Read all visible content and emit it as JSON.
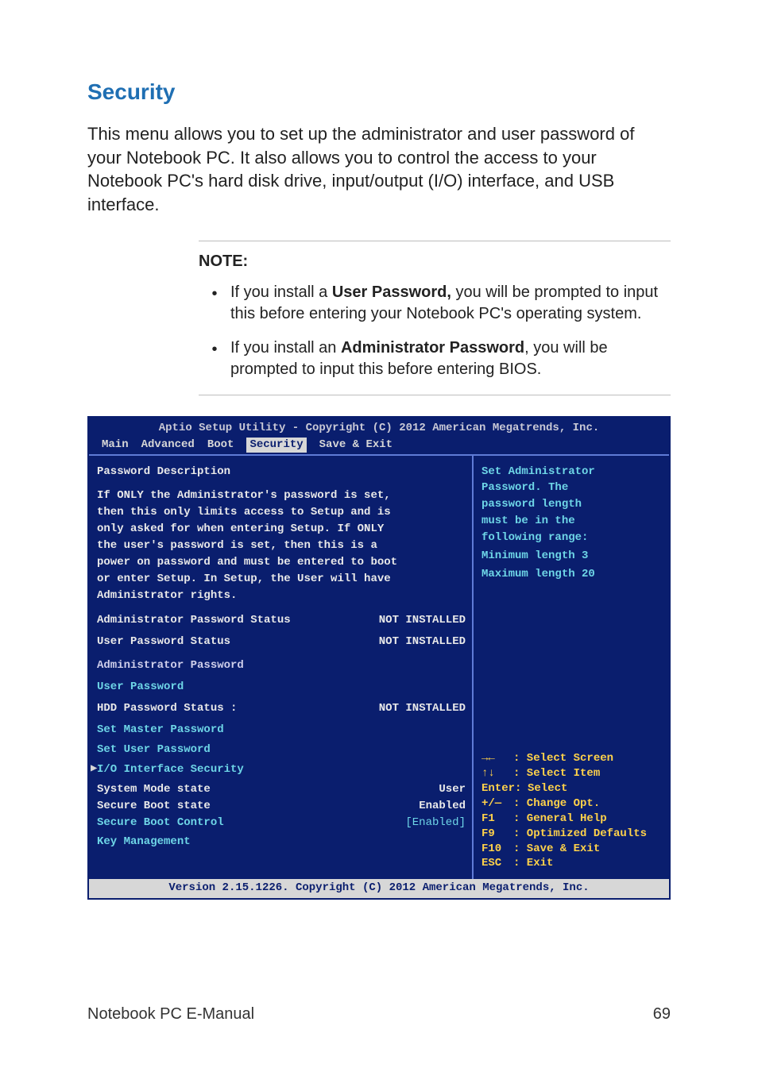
{
  "heading": "Security",
  "intro": "This menu allows you to set up the administrator and user password of your Notebook PC. It also allows you to control the access to your Notebook PC's hard disk drive, input/output (I/O) interface, and USB interface.",
  "note": {
    "title": "NOTE:",
    "items": [
      {
        "pre": "If you install a ",
        "bold": "User Password,",
        "post": " you will be prompted to input this before entering your Notebook PC's operating system."
      },
      {
        "pre": "If you install an ",
        "bold": "Administrator Password",
        "post": ", you will be prompted to input this before entering BIOS."
      }
    ]
  },
  "bios": {
    "header": "Aptio Setup Utility - Copyright (C) 2012 American Megatrends, Inc.",
    "tabs": [
      "Main",
      "Advanced",
      "Boot",
      "Security",
      "Save & Exit"
    ],
    "active_tab": "Security",
    "left": {
      "pd_title": "Password Description",
      "pd_lines": [
        "If ONLY the Administrator's password is set,",
        "then this only limits access to Setup and is",
        "only asked for when entering Setup. If ONLY",
        "the user's password is set, then this is a",
        "power on password and must be entered to boot",
        "or enter Setup. In Setup, the User will have",
        "Administrator rights."
      ],
      "rows": [
        {
          "label": "Administrator Password Status",
          "value": "NOT INSTALLED",
          "cls": "white-bold"
        },
        {
          "label": "User Password Status",
          "value": "NOT INSTALLED",
          "cls": "white-bold"
        }
      ],
      "admin_pw": "Administrator Password",
      "user_pw": "User Password",
      "hdd_row": {
        "label": "HDD Password Status :",
        "value": "NOT INSTALLED"
      },
      "set_master": "Set Master Password",
      "set_user": "Set User Password",
      "io_sec": "I/O Interface Security",
      "sys_mode": {
        "label": "System Mode state",
        "value": "User"
      },
      "secure_state": {
        "label": "Secure Boot state",
        "value": "Enabled"
      },
      "secure_ctrl": {
        "label": "Secure Boot Control",
        "value": "[Enabled]"
      },
      "key_mgmt": "Key Management"
    },
    "right": {
      "desc": [
        "Set Administrator",
        "Password. The",
        "password length",
        "must be in the",
        "following range:",
        "",
        "Minimum length 3",
        "",
        "Maximum length 20"
      ],
      "help": [
        {
          "key": "→←",
          "text": ": Select Screen"
        },
        {
          "key": "↑↓",
          "text": ": Select Item"
        },
        {
          "key": "Enter:",
          "text": "Select",
          "wide": true
        },
        {
          "key": "+/—",
          "text": ": Change Opt."
        },
        {
          "key": "F1",
          "text": ": General Help"
        },
        {
          "key": "F9",
          "text": ": Optimized Defaults"
        },
        {
          "key": "F10",
          "text": ": Save & Exit"
        },
        {
          "key": "ESC",
          "text": ": Exit"
        }
      ]
    },
    "footer": "Version 2.15.1226. Copyright (C) 2012 American Megatrends, Inc."
  },
  "page_footer": {
    "left": "Notebook PC E-Manual",
    "right": "69"
  }
}
